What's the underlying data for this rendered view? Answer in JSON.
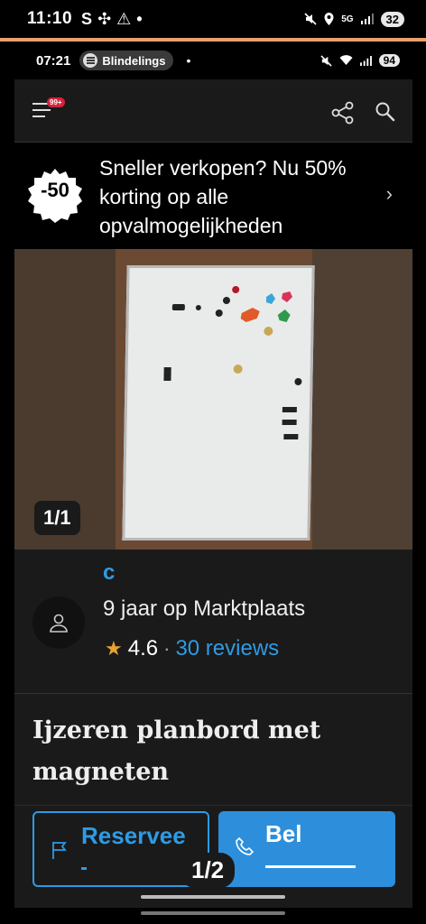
{
  "outer_status": {
    "time": "11:10",
    "icons_left": [
      "S",
      "✣",
      "⚠",
      "•"
    ],
    "network": "5G",
    "battery": "32"
  },
  "inner_status": {
    "time": "07:21",
    "spotify_label": "Blindelings",
    "battery": "94"
  },
  "header": {
    "badge": "99+"
  },
  "promo": {
    "badge": "-50",
    "text": "Sneller verkopen? Nu 50% korting op alle opvalmogelijkheden",
    "chevron": "›"
  },
  "photo": {
    "counter": "1/1"
  },
  "seller": {
    "name": "c",
    "years": "9 jaar op Marktplaats",
    "rating": "4.6",
    "separator": "·",
    "reviews": "30 reviews"
  },
  "listing": {
    "title": "Ijzeren planbord met magneten"
  },
  "actions": {
    "reserve_label": "Reservee",
    "call_label": "Bel"
  },
  "pager": "1/2",
  "colors": {
    "accent": "#2d9be5",
    "star": "#e8a32d",
    "orange_line": "#e8a070",
    "badge_red": "#d9223b"
  }
}
